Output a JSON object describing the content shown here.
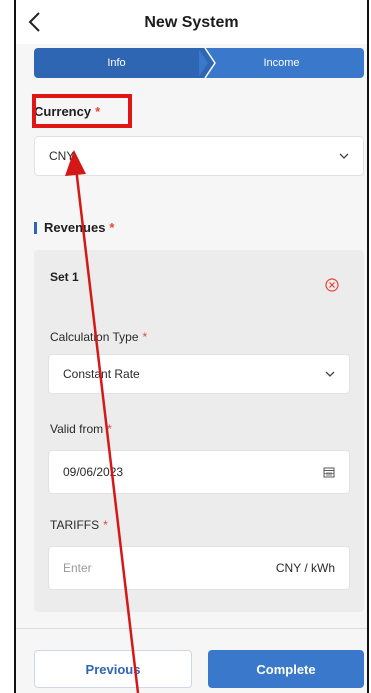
{
  "header": {
    "title": "New System",
    "back_icon": "chevron-left-icon"
  },
  "steps": [
    {
      "label": "Info"
    },
    {
      "label": "Income"
    }
  ],
  "currency": {
    "label": "Currency",
    "required_mark": "*",
    "value": "CNY"
  },
  "revenues": {
    "label": "Revenues",
    "required_mark": "*",
    "set": {
      "title": "Set 1",
      "remove_icon": "close-circle-icon",
      "calculation_type": {
        "label": "Calculation Type",
        "required_mark": "*",
        "value": "Constant Rate"
      },
      "valid_from": {
        "label": "Valid from",
        "required_mark": "*",
        "value": "09/06/2023",
        "icon": "calendar-icon"
      },
      "tariffs": {
        "label": "TARIFFS",
        "required_mark": "*",
        "placeholder": "Enter",
        "unit": "CNY / kWh"
      }
    }
  },
  "footer": {
    "previous_label": "Previous",
    "complete_label": "Complete"
  },
  "colors": {
    "primary": "#2f66b3",
    "primary_light": "#3a78cc",
    "required": "#e0483e",
    "annotation_red": "#e01515"
  }
}
